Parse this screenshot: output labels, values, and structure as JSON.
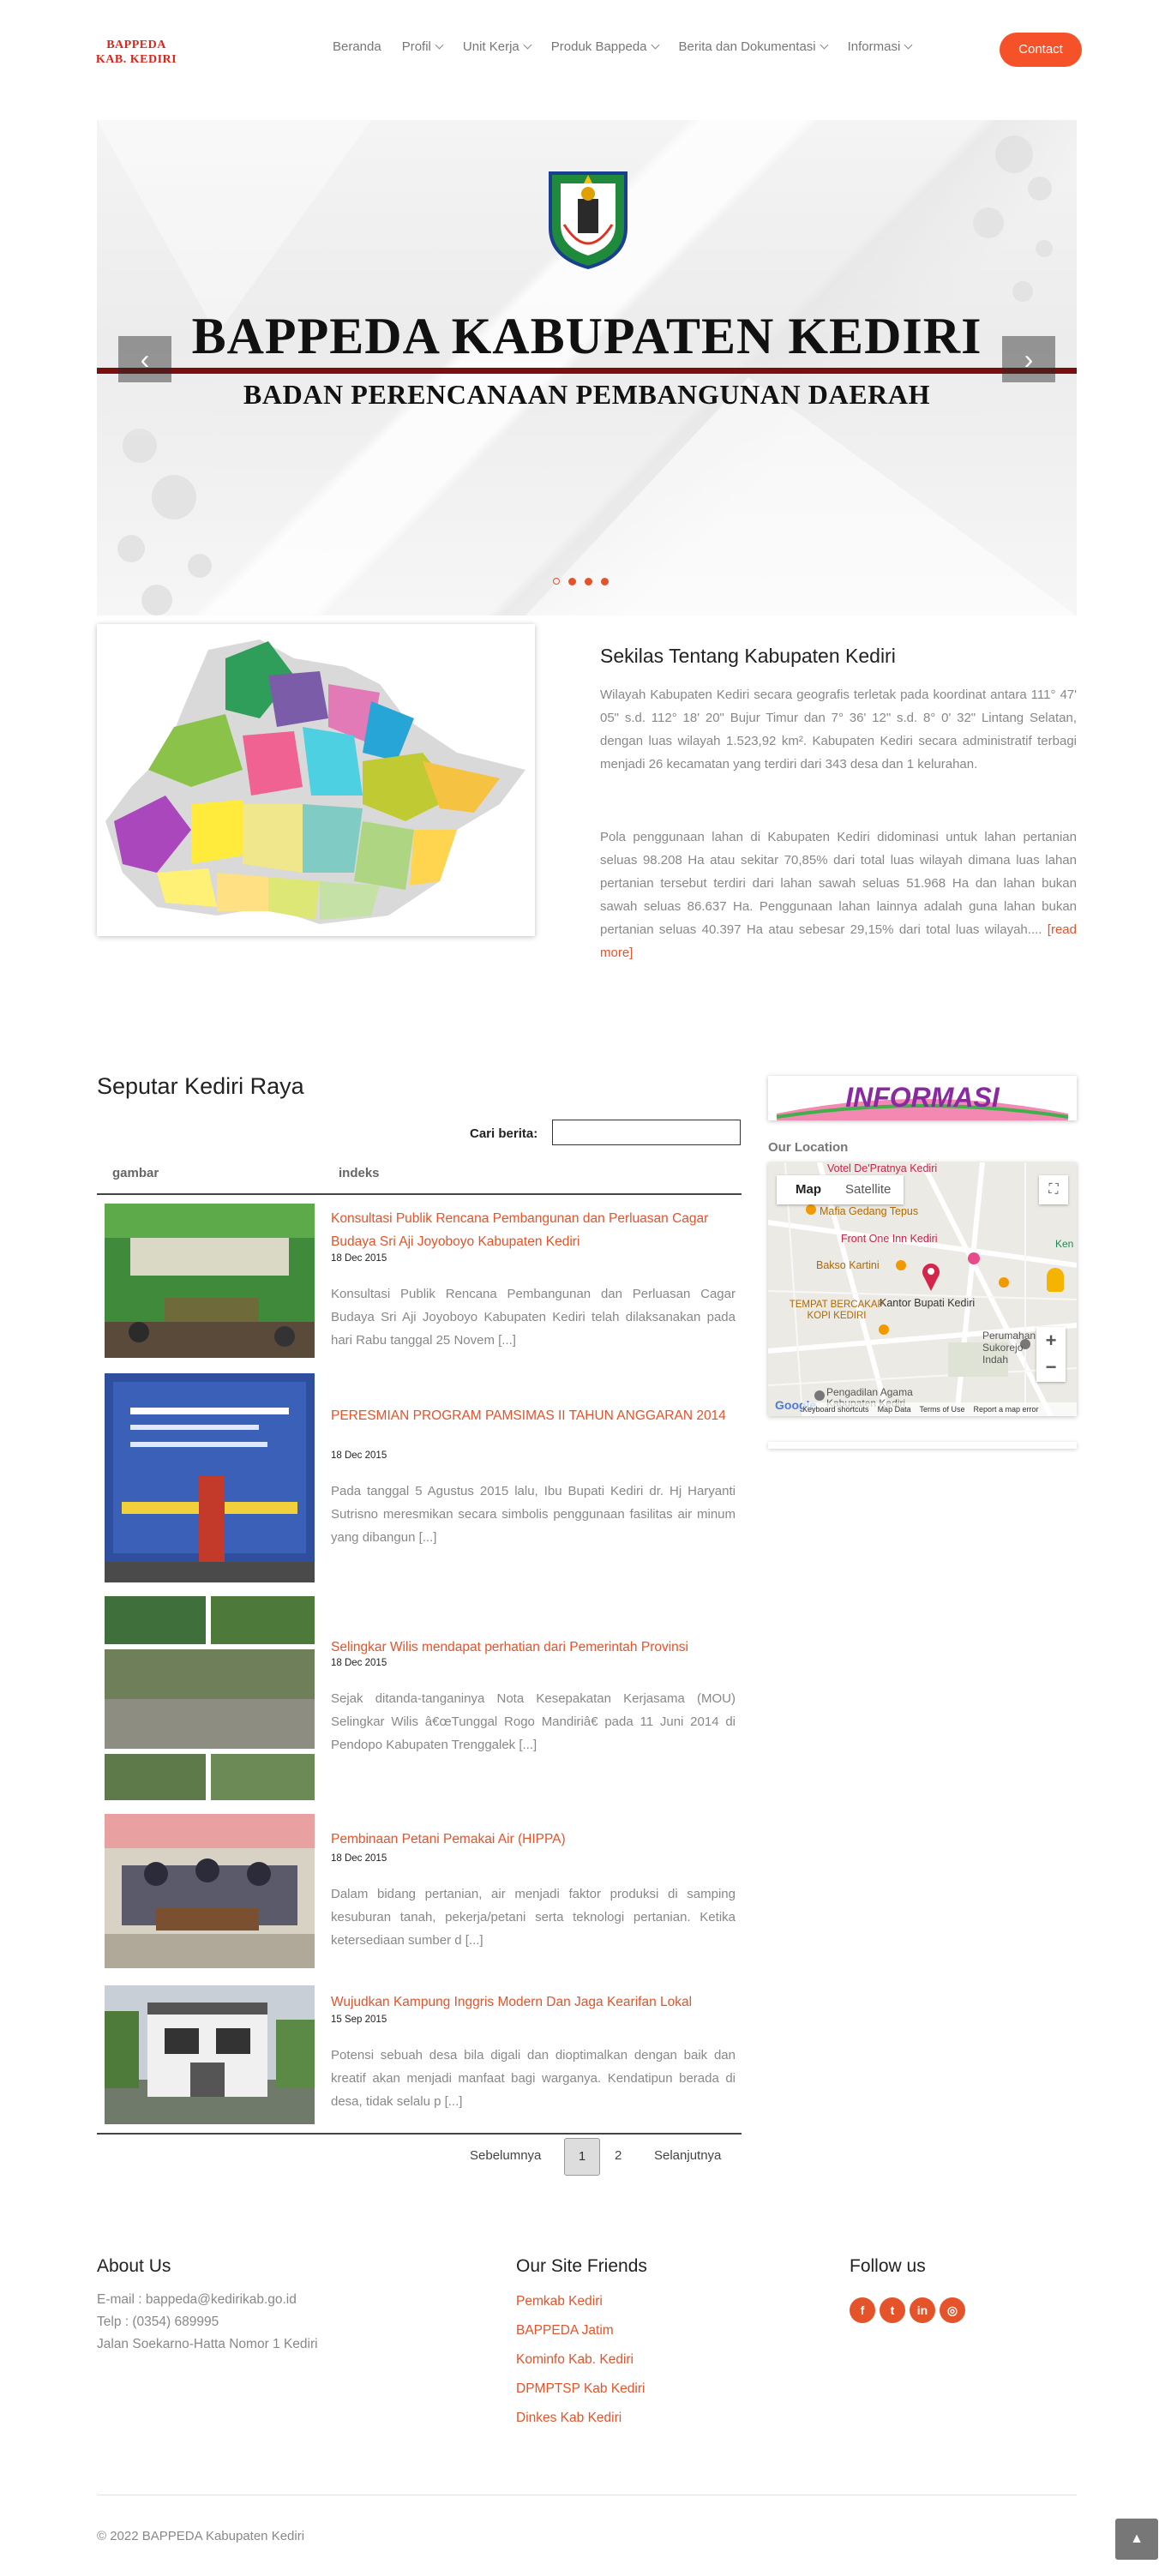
{
  "header": {
    "logo_line1": "BAPPEDA",
    "logo_line2": "KAB. KEDIRI",
    "nav": [
      {
        "label": "Beranda",
        "has_dropdown": false
      },
      {
        "label": "Profil",
        "has_dropdown": true
      },
      {
        "label": "Unit Kerja",
        "has_dropdown": true
      },
      {
        "label": "Produk Bappeda",
        "has_dropdown": true
      },
      {
        "label": "Berita dan Dokumentasi",
        "has_dropdown": true
      },
      {
        "label": "Informasi",
        "has_dropdown": true
      }
    ],
    "contact_label": "Contact"
  },
  "hero": {
    "title": "BAPPEDA KABUPATEN KEDIRI",
    "subtitle": "BADAN PERENCANAAN PEMBANGUNAN DAERAH",
    "prev_icon": "chevron-left-icon",
    "next_icon": "chevron-right-icon",
    "slide_count": 4,
    "active_slide": 1
  },
  "intro": {
    "title": "Sekilas Tentang Kabupaten Kediri",
    "p1": "Wilayah Kabupaten Kediri secara geografis terletak pada koordinat antara 111° 47' 05\" s.d. 112° 18' 20\" Bujur Timur dan 7° 36' 12\" s.d. 8° 0' 32\" Lintang Selatan, dengan luas wilayah 1.523,92 km². Kabupaten Kediri secara administratif terbagi menjadi 26 kecamatan yang terdiri dari 343 desa dan 1 kelurahan.",
    "p2": "Pola penggunaan lahan di Kabupaten Kediri didominasi untuk lahan pertanian seluas 98.208 Ha atau sekitar 70,85% dari total luas wilayah dimana luas lahan pertanian tersebut terdiri dari lahan sawah seluas 51.968 Ha dan lahan bukan sawah seluas 86.637 Ha. Penggunaan lahan lainnya adalah guna lahan bukan pertanian seluas 40.397 Ha atau sebesar 29,15% dari total luas wilayah.... ",
    "read_more": "[read more]"
  },
  "news": {
    "section_title": "Seputar Kediri Raya",
    "search_label": "Cari berita:",
    "col_gambar": "gambar",
    "col_indeks": "indeks",
    "items": [
      {
        "title": "Konsultasi Publik Rencana Pembangunan dan Perluasan Cagar Budaya Sri Aji Joyoboyo Kabupaten Kediri",
        "date": "18 Dec 2015",
        "excerpt": "Konsultasi Publik Rencana Pembangunan dan Perluasan Cagar Budaya Sri Aji Joyoboyo Kabupaten Kediri telah dilaksanakan pada hari Rabu tanggal 25 Novem [...]"
      },
      {
        "title": "PERESMIAN PROGRAM PAMSIMAS II TAHUN ANGGARAN 2014",
        "date": "18 Dec 2015",
        "excerpt": "Pada tanggal 5 Agustus 2015 lalu, Ibu Bupati Kediri dr. Hj Haryanti Sutrisno meresmikan secara simbolis penggunaan fasilitas air minum yang dibangun [...]"
      },
      {
        "title": "Selingkar Wilis mendapat perhatian dari Pemerintah Provinsi",
        "date": "18 Dec 2015",
        "excerpt": "Sejak ditanda-tanganinya Nota Kesepakatan Kerjasama (MOU) Selingkar Wilis â€œTunggal Rogo Mandiriâ€ pada 11 Juni 2014 di Pendopo Kabupaten Trenggalek [...]"
      },
      {
        "title": "Pembinaan Petani Pemakai Air (HIPPA)",
        "date": "18 Dec 2015",
        "excerpt": "Dalam bidang pertanian, air menjadi faktor produksi di samping kesuburan tanah, pekerja/petani serta teknologi pertanian. Ketika ketersediaan sumber d [...]"
      },
      {
        "title": "Wujudkan Kampung Inggris Modern Dan Jaga Kearifan Lokal",
        "date": "15 Sep 2015",
        "excerpt": "Potensi sebuah desa bila digali dan dioptimalkan dengan baik dan kreatif akan menjadi manfaat bagi warganya. Kendatipun berada di desa, tidak selalu p [...]"
      }
    ],
    "pager": {
      "prev": "Sebelumnya",
      "current": "1",
      "page2": "2",
      "next": "Selanjutnya"
    }
  },
  "sidebar": {
    "banner_text": "INFORMASI",
    "location_label": "Our Location",
    "map": {
      "tab_map": "Map",
      "tab_satellite": "Satellite",
      "places": [
        "Votel De'Pratnya Kediri",
        "Mafia Gedang Tepus",
        "Front One Inn Kediri",
        "Bakso Kartini",
        "Kantor Bupati Kediri",
        "TEMPAT BERCAKAP KOPI KEDIRI",
        "Perumahan Sukorejo Indah",
        "Pengadilan Agama Kabupaten Kediri",
        "Ken"
      ],
      "zoom_in": "+",
      "zoom_out": "−",
      "footer": [
        "Keyboard shortcuts",
        "Map Data",
        "Terms of Use",
        "Report a map error"
      ],
      "google": "Google"
    }
  },
  "footer": {
    "about_title": "About Us",
    "about_lines": [
      "E-mail : bappeda@kedirikab.go.id",
      "Telp : (0354) 689995",
      "Jalan Soekarno-Hatta Nomor 1 Kediri"
    ],
    "friends_title": "Our Site Friends",
    "friends": [
      "Pemkab Kediri",
      "BAPPEDA Jatim",
      "Kominfo Kab. Kediri",
      "DPMPTSP Kab Kediri",
      "Dinkes Kab Kediri"
    ],
    "follow_title": "Follow us",
    "social": [
      {
        "icon": "facebook-icon",
        "glyph": "f"
      },
      {
        "icon": "twitter-icon",
        "glyph": "t"
      },
      {
        "icon": "linkedin-icon",
        "glyph": "in"
      },
      {
        "icon": "instagram-icon",
        "glyph": "◎"
      }
    ],
    "copyright": "© 2022 BAPPEDA Kabupaten Kediri",
    "to_top_icon": "arrow-up-icon"
  },
  "colors": {
    "accent": "#e4532a",
    "contact_button": "#f5522a",
    "hero_rule": "#7a0f10"
  }
}
